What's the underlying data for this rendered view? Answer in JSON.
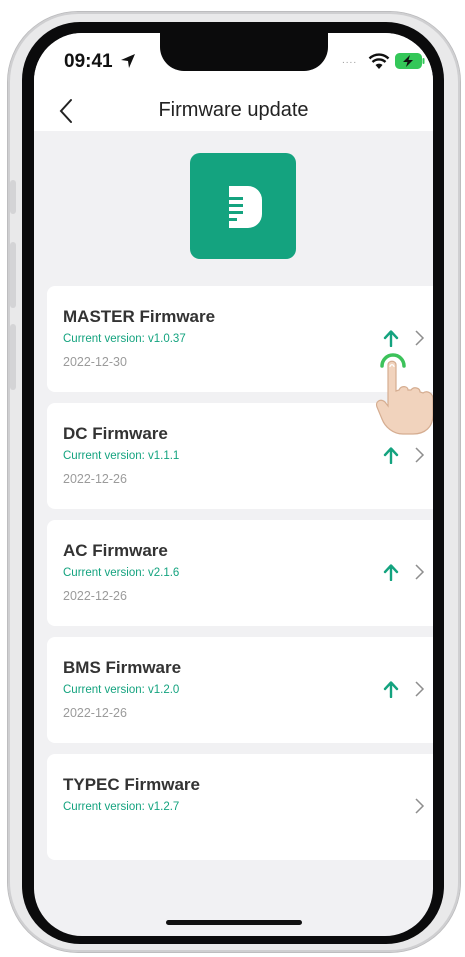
{
  "status_bar": {
    "time": "09:41",
    "dots": "....",
    "icons": [
      "location-arrow-icon",
      "wifi-icon",
      "battery-charging-icon"
    ]
  },
  "nav": {
    "title": "Firmware update",
    "back_icon": "chevron-left-icon"
  },
  "logo": {
    "icon": "device-d-logo",
    "color": "#14a37f"
  },
  "colors": {
    "accent": "#14a37f",
    "background": "#f1f1f3",
    "card": "#ffffff"
  },
  "firmware_items": [
    {
      "title": "MASTER Firmware",
      "version": "Current version: v1.0.37",
      "date": "2022-12-30",
      "has_update": true
    },
    {
      "title": "DC Firmware",
      "version": "Current version: v1.1.1",
      "date": "2022-12-26",
      "has_update": true
    },
    {
      "title": "AC Firmware",
      "version": "Current version: v2.1.6",
      "date": "2022-12-26",
      "has_update": true
    },
    {
      "title": "BMS Firmware",
      "version": "Current version: v1.2.0",
      "date": "2022-12-26",
      "has_update": true
    },
    {
      "title": "TYPEC Firmware",
      "version": "Current version: v1.2.7",
      "date": "",
      "has_update": false
    }
  ]
}
